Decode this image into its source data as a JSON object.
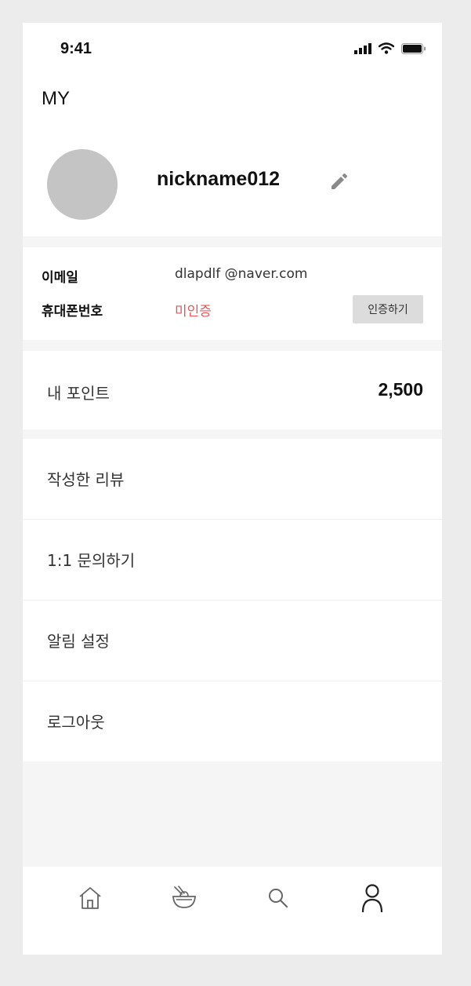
{
  "status_bar": {
    "time": "9:41",
    "icons": [
      "signal-icon",
      "wifi-icon",
      "battery-icon"
    ]
  },
  "header": {
    "title": "MY"
  },
  "profile": {
    "nickname": "nickname012",
    "edit_icon": "pencil-icon"
  },
  "account": {
    "email_label": "이메일",
    "email_value": "dlapdlf @naver.com",
    "phone_label": "휴대폰번호",
    "phone_status": "미인증",
    "verify_button": "인증하기"
  },
  "points": {
    "label": "내 포인트",
    "value": "2,500"
  },
  "menu": {
    "items": [
      {
        "label": "작성한 리뷰"
      },
      {
        "label": "1:1 문의하기"
      },
      {
        "label": "알림 설정"
      },
      {
        "label": "로그아웃"
      }
    ]
  },
  "tab_bar": {
    "tabs": [
      {
        "icon": "home-icon"
      },
      {
        "icon": "bowl-icon"
      },
      {
        "icon": "search-icon"
      },
      {
        "icon": "person-icon",
        "active": true
      }
    ]
  },
  "colors": {
    "unverified": "#e05a5a",
    "avatar_placeholder": "#c4c4c4",
    "page_background": "#f5f5f5"
  }
}
